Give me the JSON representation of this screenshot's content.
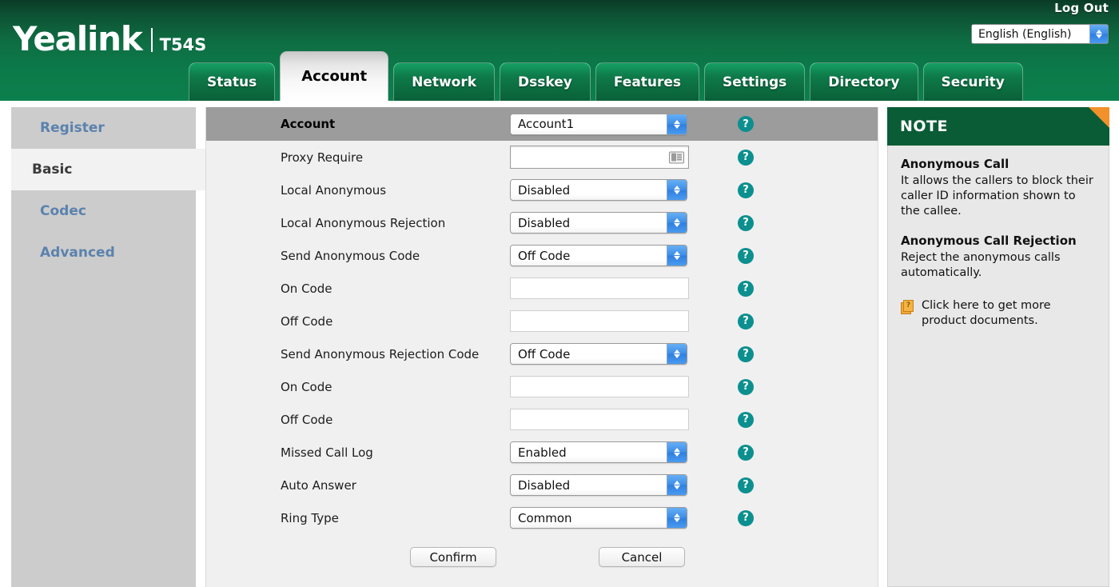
{
  "header": {
    "logout_label": "Log Out",
    "brand_name": "Yealink",
    "brand_model": "T54S",
    "language": {
      "selected": "English (English)",
      "icon": "spinner-arrows-icon"
    }
  },
  "tabs": [
    {
      "label": "Status",
      "active": false
    },
    {
      "label": "Account",
      "active": true
    },
    {
      "label": "Network",
      "active": false
    },
    {
      "label": "Dsskey",
      "active": false
    },
    {
      "label": "Features",
      "active": false
    },
    {
      "label": "Settings",
      "active": false
    },
    {
      "label": "Directory",
      "active": false
    },
    {
      "label": "Security",
      "active": false
    }
  ],
  "sidebar": {
    "items": [
      {
        "label": "Register",
        "active": false
      },
      {
        "label": "Basic",
        "active": true
      },
      {
        "label": "Codec",
        "active": false
      },
      {
        "label": "Advanced",
        "active": false
      }
    ]
  },
  "form": {
    "header_row": {
      "label": "Account",
      "value": "Account1",
      "help_icon": "question-mark-icon"
    },
    "rows": [
      {
        "label": "Proxy Require",
        "type": "text",
        "value": "",
        "placeholder": "",
        "icon": "contact-card-icon",
        "help_icon": "question-mark-icon"
      },
      {
        "label": "Local Anonymous",
        "type": "select",
        "value": "Disabled",
        "help_icon": "question-mark-icon"
      },
      {
        "label": "Local Anonymous Rejection",
        "type": "select",
        "value": "Disabled",
        "help_icon": "question-mark-icon"
      },
      {
        "label": "Send Anonymous Code",
        "type": "select",
        "value": "Off Code",
        "help_icon": "question-mark-icon"
      },
      {
        "label": "On Code",
        "type": "text",
        "value": "",
        "placeholder": "",
        "help_icon": "question-mark-icon"
      },
      {
        "label": "Off Code",
        "type": "text",
        "value": "",
        "placeholder": "",
        "help_icon": "question-mark-icon"
      },
      {
        "label": "Send Anonymous Rejection Code",
        "type": "select",
        "value": "Off Code",
        "help_icon": "question-mark-icon"
      },
      {
        "label": "On Code",
        "type": "text",
        "value": "",
        "placeholder": "",
        "help_icon": "question-mark-icon"
      },
      {
        "label": "Off Code",
        "type": "text",
        "value": "",
        "placeholder": "",
        "help_icon": "question-mark-icon"
      },
      {
        "label": "Missed Call Log",
        "type": "select",
        "value": "Enabled",
        "help_icon": "question-mark-icon"
      },
      {
        "label": "Auto Answer",
        "type": "select",
        "value": "Disabled",
        "help_icon": "question-mark-icon"
      },
      {
        "label": "Ring Type",
        "type": "select",
        "value": "Common",
        "help_icon": "question-mark-icon"
      }
    ],
    "confirm_label": "Confirm",
    "cancel_label": "Cancel"
  },
  "note": {
    "title": "NOTE",
    "sections": [
      {
        "heading": "Anonymous Call",
        "text": "It allows the callers to block their caller ID information shown to the callee."
      },
      {
        "heading": "Anonymous Call Rejection",
        "text": "Reject the anonymous calls automatically."
      }
    ],
    "link_text": "Click here to get more product documents.",
    "link_icon": "documents-help-icon"
  },
  "colors": {
    "brand_green": "#0b7f4d",
    "note_green": "#0a5c36",
    "accent_orange": "#f2902a",
    "help_teal": "#0c8f8f",
    "spinner_blue": "#3d8ee8",
    "sidebar_gray": "#cccccc",
    "header_row_gray": "#9c9c9c"
  }
}
